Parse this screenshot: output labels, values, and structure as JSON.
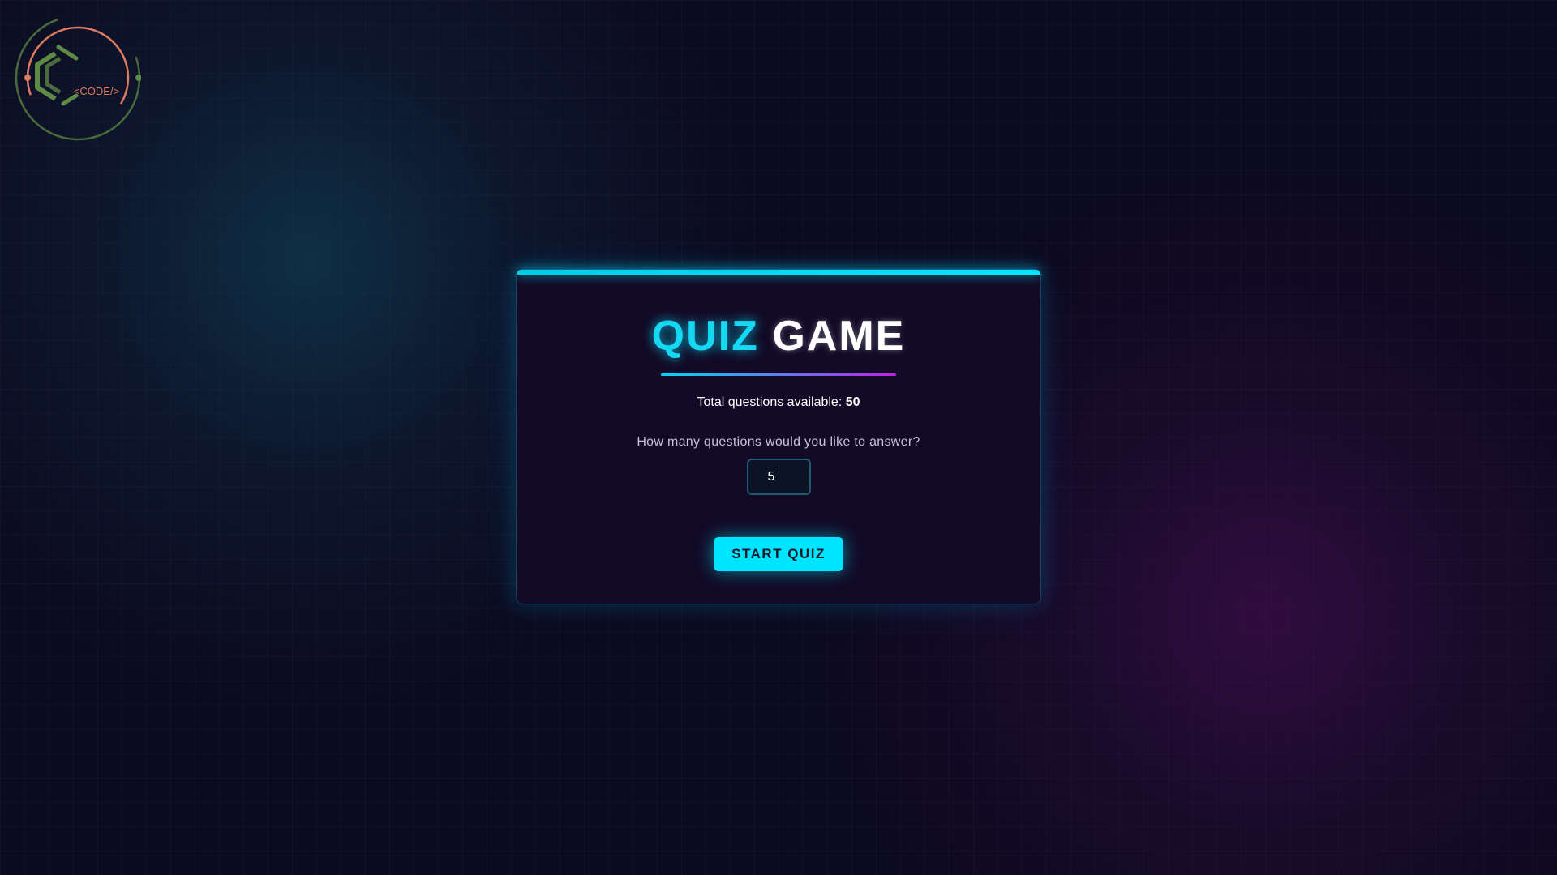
{
  "logo": {
    "text": "<CODE/>",
    "icon": "code-logo-icon"
  },
  "quiz": {
    "title_accent": "QUIZ",
    "title_plain": "GAME",
    "total_label": "Total questions available:",
    "total_count": "50",
    "question_prompt": "How many questions would you like to answer?",
    "question_count_value": "5",
    "start_button_label": "START QUIZ"
  },
  "colors": {
    "accent_cyan": "#00e5ff",
    "accent_magenta": "#c020e8",
    "card_background": "#120a26",
    "page_background": "#0c0a1e"
  }
}
